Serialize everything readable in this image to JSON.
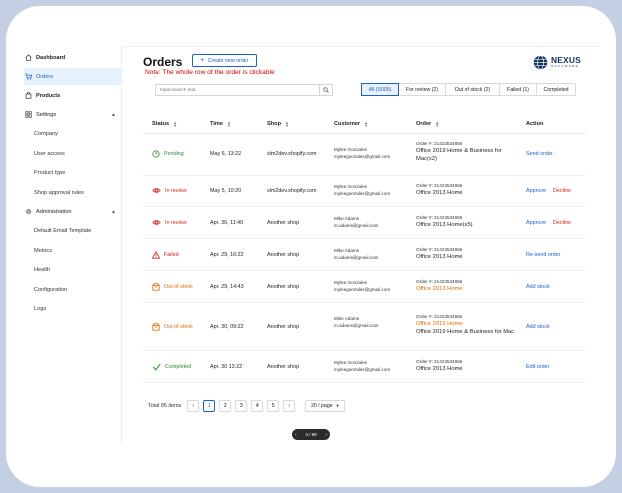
{
  "sidebar": {
    "items": [
      {
        "label": "Dashboard",
        "icon": "home-icon"
      },
      {
        "label": "Orders",
        "icon": "cart-icon",
        "active": true
      },
      {
        "label": "Products",
        "icon": "bag-icon"
      },
      {
        "label": "Settings",
        "icon": "grid-icon"
      },
      {
        "label": "Company"
      },
      {
        "label": "User access"
      },
      {
        "label": "Product type"
      },
      {
        "label": "Shop approval rules"
      },
      {
        "label": "Administration",
        "icon": "gear-icon"
      },
      {
        "label": "Default Email Template"
      },
      {
        "label": "Metrics"
      },
      {
        "label": "Health"
      },
      {
        "label": "Configuration"
      },
      {
        "label": "Logs"
      }
    ]
  },
  "header": {
    "title": "Orders",
    "create_label": "Create new order",
    "note": "Note: The whole row of the order is clickable",
    "logo_line1": "NEXUS",
    "logo_line2": "SOFTWARE"
  },
  "search": {
    "placeholder": "Input search text"
  },
  "filters": [
    "All (S005)",
    "For review (2)",
    "Out of stock (2)",
    "Failed (1)",
    "Completed"
  ],
  "table": {
    "headers": [
      "Status",
      "Time",
      "Shop",
      "Customer",
      "Order",
      "Action"
    ],
    "rows": [
      {
        "status": "Pending",
        "status_color": "#2e8b2e",
        "time": "May 6, 13:22",
        "shop": "slm2dev.shopify.com",
        "customer": [
          "Mylee Gonzales",
          "myleegonzales@gmail.com"
        ],
        "order_num": "Order #: 21423534656",
        "products": [
          "Office 2019 Home & Business for",
          "Mac(x2)"
        ],
        "product_warn": false,
        "actions": [
          "Send order"
        ]
      },
      {
        "status": "In review",
        "status_color": "#d22222",
        "time": "May 5, 10:20",
        "shop": "slm2dev.shopify.com",
        "customer": [
          "Mylee Gonzales",
          "myleegonzales@gmail.com"
        ],
        "order_num": "Order #: 21423534656",
        "products": [
          "Office 2013 Home"
        ],
        "product_warn": false,
        "actions": [
          "Approve",
          "Decline"
        ]
      },
      {
        "status": "In review",
        "status_color": "#d22222",
        "time": "Apr. 30, 11:40",
        "shop": "Another shop",
        "customer": [
          "Mike Adams",
          "m.adams@gmail.com"
        ],
        "order_num": "Order #: 21423534656",
        "products": [
          "Office 2013 Home(x5)"
        ],
        "product_warn": false,
        "actions": [
          "Approve",
          "Decline"
        ]
      },
      {
        "status": "Failed",
        "status_color": "#d22222",
        "time": "Apr. 29, 16:22",
        "shop": "Another shop",
        "customer": [
          "Mike Adams",
          "m.adams@gmail.com"
        ],
        "order_num": "Order #: 21423534656",
        "products": [
          "Office 2013 Home"
        ],
        "product_warn": false,
        "actions": [
          "Re-send order"
        ]
      },
      {
        "status": "Out of stock",
        "status_color": "#e06c00",
        "time": "Apr. 29, 14:43",
        "shop": "Another shop",
        "customer": [
          "Mylee Gonzales",
          "myleegonzales@gmail.com"
        ],
        "order_num": "Order #: 21423534656",
        "products": [
          "Office 2013 Home"
        ],
        "product_warn": true,
        "actions": [
          "Add stock"
        ]
      },
      {
        "status": "Out of stock",
        "status_color": "#e06c00",
        "time": "Apr. 30, 09:22",
        "shop": "Another shop",
        "customer": [
          "Mike Adams",
          "m.adams@gmail.com"
        ],
        "order_num": "Order #: 21423534656",
        "products": [
          "Office 2013 Home",
          "Office 2019 Home & Business for Mac"
        ],
        "product_warn": true,
        "actions": [
          "Add stock"
        ]
      },
      {
        "status": "Completed",
        "status_color": "#2e8b2e",
        "time": "Apr. 30 13:22",
        "shop": "Another shop",
        "customer": [
          "Mylee Gonzales",
          "myleegonzales@gmail.com"
        ],
        "order_num": "Order #: 21423534656",
        "products": [
          "Office 2013 Home"
        ],
        "product_warn": false,
        "actions": [
          "Edit order"
        ]
      }
    ]
  },
  "pagination": {
    "total": "Total 85 items",
    "prev": "‹",
    "pages": [
      "1",
      "2",
      "3",
      "4",
      "5"
    ],
    "current": "1",
    "next": "›",
    "page_size": "20 / page"
  },
  "pager_pill": {
    "label": "4 / 68"
  }
}
